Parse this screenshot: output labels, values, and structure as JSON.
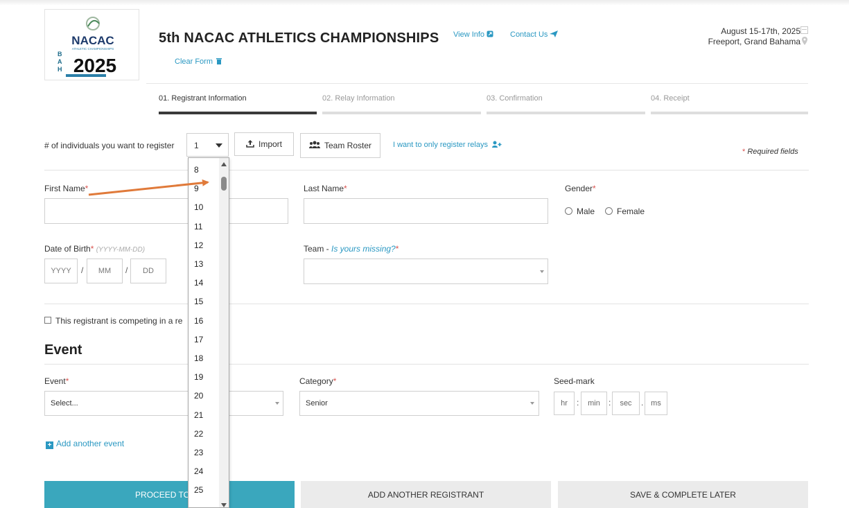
{
  "header": {
    "title": "5th NACAC ATHLETICS CHAMPIONSHIPS",
    "view_info": "View Info",
    "contact_us": "Contact Us",
    "clear_form": "Clear Form",
    "date": "August 15-17th, 2025",
    "location": "Freeport, Grand Bahama",
    "logo": {
      "word": "NACAC",
      "subtitle": "ATHLETIC CHAMPIONSHIPS",
      "year": "2025",
      "side_letters": [
        "B",
        "A",
        "H"
      ]
    }
  },
  "steps": [
    {
      "label": "01. Registrant Information",
      "active": true
    },
    {
      "label": "02. Relay Information",
      "active": false
    },
    {
      "label": "03. Confirmation",
      "active": false
    },
    {
      "label": "04. Receipt",
      "active": false
    }
  ],
  "registration": {
    "count_label": "# of individuals you want to register",
    "count_value": "1",
    "import_label": "Import",
    "team_roster_label": "Team Roster",
    "relays_only_link": "I want to only register relays",
    "required_note": "Required fields",
    "required_star": "*"
  },
  "dropdown_options": [
    "8",
    "9",
    "10",
    "11",
    "12",
    "13",
    "14",
    "15",
    "16",
    "17",
    "18",
    "19",
    "20",
    "21",
    "22",
    "23",
    "24",
    "25"
  ],
  "form": {
    "first_name_label": "First Name",
    "last_name_label": "Last Name",
    "gender_label": "Gender",
    "gender_options": [
      "Male",
      "Female"
    ],
    "dob_label": "Date of Birth",
    "dob_hint": "(YYYY-MM-DD)",
    "dob_placeholders": {
      "year": "YYYY",
      "month": "MM",
      "day": "DD"
    },
    "dob_separator": "/",
    "team_label": "Team - ",
    "team_missing_link": "Is yours missing?",
    "relay_checkbox_label": "This registrant is competing in a re"
  },
  "event_section": {
    "title": "Event",
    "event_label": "Event",
    "event_value": "Select...",
    "category_label": "Category",
    "category_value": "Senior",
    "seed_label": "Seed-mark",
    "seed_placeholders": [
      "hr",
      "min",
      "sec",
      "ms"
    ],
    "seed_separators": [
      ":",
      ":",
      "."
    ],
    "add_event": "Add another event"
  },
  "buttons": {
    "proceed": "PROCEED TO NE",
    "add_registrant": "ADD ANOTHER REGISTRANT",
    "save_later": "SAVE & COMPLETE LATER"
  },
  "colors": {
    "accent": "#2a98c2",
    "primary_button": "#3aa7bd",
    "required": "#d9534f",
    "annotation_arrow": "#e07a3a"
  }
}
